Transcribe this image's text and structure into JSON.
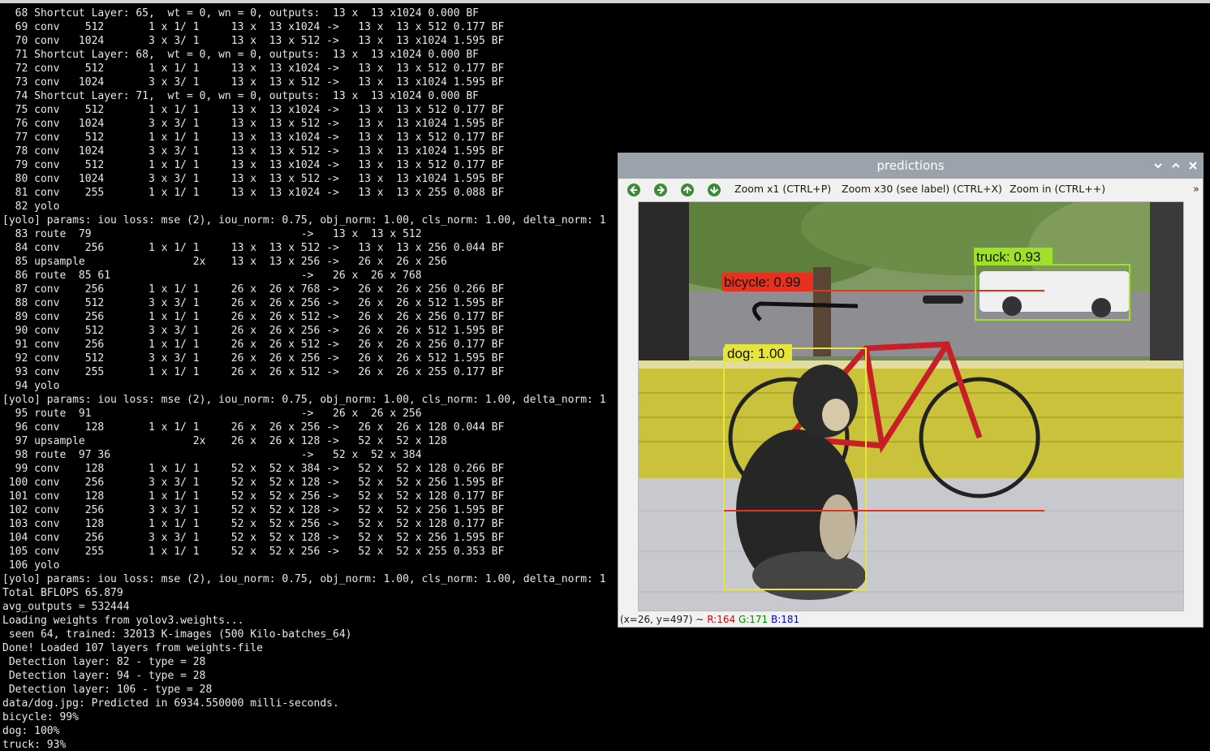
{
  "terminal": {
    "lines": [
      "  68 Shortcut Layer: 65,  wt = 0, wn = 0, outputs:  13 x  13 x1024 0.000 BF",
      "  69 conv    512       1 x 1/ 1     13 x  13 x1024 ->   13 x  13 x 512 0.177 BF",
      "  70 conv   1024       3 x 3/ 1     13 x  13 x 512 ->   13 x  13 x1024 1.595 BF",
      "  71 Shortcut Layer: 68,  wt = 0, wn = 0, outputs:  13 x  13 x1024 0.000 BF",
      "  72 conv    512       1 x 1/ 1     13 x  13 x1024 ->   13 x  13 x 512 0.177 BF",
      "  73 conv   1024       3 x 3/ 1     13 x  13 x 512 ->   13 x  13 x1024 1.595 BF",
      "  74 Shortcut Layer: 71,  wt = 0, wn = 0, outputs:  13 x  13 x1024 0.000 BF",
      "  75 conv    512       1 x 1/ 1     13 x  13 x1024 ->   13 x  13 x 512 0.177 BF",
      "  76 conv   1024       3 x 3/ 1     13 x  13 x 512 ->   13 x  13 x1024 1.595 BF",
      "  77 conv    512       1 x 1/ 1     13 x  13 x1024 ->   13 x  13 x 512 0.177 BF",
      "  78 conv   1024       3 x 3/ 1     13 x  13 x 512 ->   13 x  13 x1024 1.595 BF",
      "  79 conv    512       1 x 1/ 1     13 x  13 x1024 ->   13 x  13 x 512 0.177 BF",
      "  80 conv   1024       3 x 3/ 1     13 x  13 x 512 ->   13 x  13 x1024 1.595 BF",
      "  81 conv    255       1 x 1/ 1     13 x  13 x1024 ->   13 x  13 x 255 0.088 BF",
      "  82 yolo",
      "[yolo] params: iou loss: mse (2), iou_norm: 0.75, obj_norm: 1.00, cls_norm: 1.00, delta_norm: 1",
      "  83 route  79                                 ->   13 x  13 x 512",
      "  84 conv    256       1 x 1/ 1     13 x  13 x 512 ->   13 x  13 x 256 0.044 BF",
      "  85 upsample                 2x    13 x  13 x 256 ->   26 x  26 x 256",
      "  86 route  85 61                              ->   26 x  26 x 768",
      "  87 conv    256       1 x 1/ 1     26 x  26 x 768 ->   26 x  26 x 256 0.266 BF",
      "  88 conv    512       3 x 3/ 1     26 x  26 x 256 ->   26 x  26 x 512 1.595 BF",
      "  89 conv    256       1 x 1/ 1     26 x  26 x 512 ->   26 x  26 x 256 0.177 BF",
      "  90 conv    512       3 x 3/ 1     26 x  26 x 256 ->   26 x  26 x 512 1.595 BF",
      "  91 conv    256       1 x 1/ 1     26 x  26 x 512 ->   26 x  26 x 256 0.177 BF",
      "  92 conv    512       3 x 3/ 1     26 x  26 x 256 ->   26 x  26 x 512 1.595 BF",
      "  93 conv    255       1 x 1/ 1     26 x  26 x 512 ->   26 x  26 x 255 0.177 BF",
      "  94 yolo",
      "[yolo] params: iou loss: mse (2), iou_norm: 0.75, obj_norm: 1.00, cls_norm: 1.00, delta_norm: 1",
      "  95 route  91                                 ->   26 x  26 x 256",
      "  96 conv    128       1 x 1/ 1     26 x  26 x 256 ->   26 x  26 x 128 0.044 BF",
      "  97 upsample                 2x    26 x  26 x 128 ->   52 x  52 x 128",
      "  98 route  97 36                              ->   52 x  52 x 384",
      "  99 conv    128       1 x 1/ 1     52 x  52 x 384 ->   52 x  52 x 128 0.266 BF",
      " 100 conv    256       3 x 3/ 1     52 x  52 x 128 ->   52 x  52 x 256 1.595 BF",
      " 101 conv    128       1 x 1/ 1     52 x  52 x 256 ->   52 x  52 x 128 0.177 BF",
      " 102 conv    256       3 x 3/ 1     52 x  52 x 128 ->   52 x  52 x 256 1.595 BF",
      " 103 conv    128       1 x 1/ 1     52 x  52 x 256 ->   52 x  52 x 128 0.177 BF",
      " 104 conv    256       3 x 3/ 1     52 x  52 x 128 ->   52 x  52 x 256 1.595 BF",
      " 105 conv    255       1 x 1/ 1     52 x  52 x 256 ->   52 x  52 x 255 0.353 BF",
      " 106 yolo",
      "[yolo] params: iou loss: mse (2), iou_norm: 0.75, obj_norm: 1.00, cls_norm: 1.00, delta_norm: 1",
      "Total BFLOPS 65.879",
      "avg_outputs = 532444",
      "Loading weights from yolov3.weights...",
      " seen 64, trained: 32013 K-images (500 Kilo-batches_64)",
      "Done! Loaded 107 layers from weights-file",
      " Detection layer: 82 - type = 28",
      " Detection layer: 94 - type = 28",
      " Detection layer: 106 - type = 28",
      "data/dog.jpg: Predicted in 6934.550000 milli-seconds.",
      "bicycle: 99%",
      "dog: 100%",
      "truck: 93%"
    ]
  },
  "window": {
    "title": "predictions",
    "toolbar": {
      "back_icon": "arrow-left-icon",
      "forward_icon": "arrow-right-icon",
      "up_icon": "arrow-up-icon",
      "down_icon": "arrow-down-icon",
      "zoom_x1": "Zoom x1 (CTRL+P)",
      "zoom_x30": "Zoom x30 (see label) (CTRL+X)",
      "zoom_in": "Zoom in (CTRL++)",
      "more": "»"
    },
    "detections": [
      {
        "label": "bicycle: 0.99",
        "color": "#e8301e"
      },
      {
        "label": "truck: 0.93",
        "color": "#9ee02b"
      },
      {
        "label": "dog: 1.00",
        "color": "#e6e63a"
      }
    ],
    "status": {
      "coords": "(x=26, y=497) ~",
      "r": "R:164",
      "g": "G:171",
      "b": "B:181"
    }
  },
  "colors": {
    "titlebar": "#9aa3ab",
    "terminal_bg": "#000000",
    "terminal_fg": "#e8e8e8",
    "nav_icon_green": "#3c8a36"
  }
}
